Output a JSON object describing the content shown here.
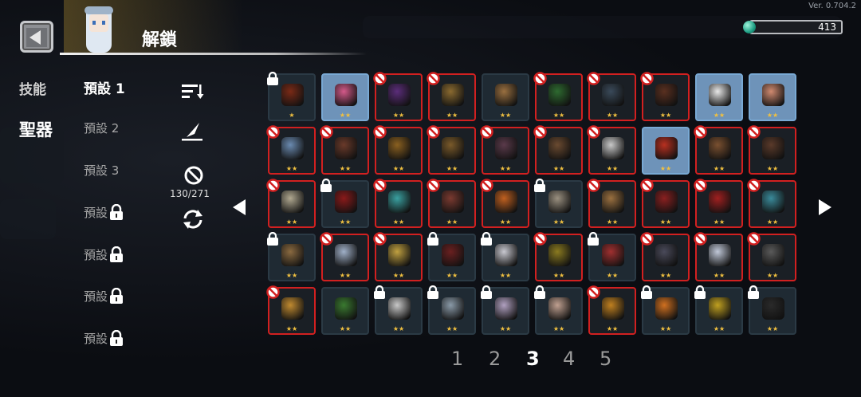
{
  "version": "Ver. 0.704.2",
  "header": {
    "title": "解鎖"
  },
  "currency": {
    "value": "413",
    "icon": "gem-icon",
    "color": "#2fc29f"
  },
  "categories": [
    {
      "label": "技能",
      "active": false
    },
    {
      "label": "聖器",
      "active": true
    }
  ],
  "presets": [
    {
      "label": "預設 1",
      "locked": false,
      "active": true
    },
    {
      "label": "預設 2",
      "locked": false,
      "active": false
    },
    {
      "label": "預設 3",
      "locked": false,
      "active": false
    },
    {
      "label": "預設",
      "locked": true,
      "active": false
    },
    {
      "label": "預設",
      "locked": true,
      "active": false
    },
    {
      "label": "預設",
      "locked": true,
      "active": false
    },
    {
      "label": "預設",
      "locked": true,
      "active": false
    }
  ],
  "tools": {
    "sort_icon": "sort-icon",
    "edit_icon": "quill-icon",
    "ban_icon": "ban-icon",
    "counter": "130/271",
    "refresh_icon": "refresh-icon"
  },
  "colors": {
    "blocked": "#d22020",
    "selected": "#79a9d4",
    "star": "#f0c040"
  },
  "items": [
    {
      "state": "locked",
      "stars": "★",
      "color": "#7a2a16"
    },
    {
      "state": "selected",
      "stars": "★★",
      "color": "#d45a8a"
    },
    {
      "state": "blocked",
      "stars": "★★",
      "color": "#5b2d7a"
    },
    {
      "state": "blocked",
      "stars": "★★",
      "color": "#8a6a30"
    },
    {
      "state": "normal",
      "stars": "★★",
      "color": "#9a7040"
    },
    {
      "state": "blocked",
      "stars": "★★",
      "color": "#2e6a30"
    },
    {
      "state": "blocked",
      "stars": "★★",
      "color": "#3a4a5a"
    },
    {
      "state": "blocked",
      "stars": "★★",
      "color": "#5a3020"
    },
    {
      "state": "selected",
      "stars": "★★",
      "color": "#e8e8e8"
    },
    {
      "state": "selected",
      "stars": "★★",
      "color": "#d08a70"
    },
    {
      "state": "blocked",
      "stars": "★★",
      "color": "#6a8ab0"
    },
    {
      "state": "blocked",
      "stars": "★★",
      "color": "#6a3a2a"
    },
    {
      "state": "blocked",
      "stars": "★★",
      "color": "#8a6020"
    },
    {
      "state": "blocked",
      "stars": "★★",
      "color": "#7a5a2a"
    },
    {
      "state": "blocked",
      "stars": "★★",
      "color": "#5a3a4a"
    },
    {
      "state": "blocked",
      "stars": "★★",
      "color": "#6a4a30"
    },
    {
      "state": "blocked",
      "stars": "★★",
      "color": "#c8c8c8"
    },
    {
      "state": "selected",
      "stars": "★★",
      "color": "#b83020"
    },
    {
      "state": "blocked",
      "stars": "★★",
      "color": "#7a5030"
    },
    {
      "state": "blocked",
      "stars": "★★",
      "color": "#5a3a2a"
    },
    {
      "state": "blocked",
      "stars": "★★",
      "color": "#b0a890"
    },
    {
      "state": "locked",
      "stars": "★★",
      "color": "#8a1a1a"
    },
    {
      "state": "blocked",
      "stars": "★★",
      "color": "#3aa0a0"
    },
    {
      "state": "blocked",
      "stars": "★★",
      "color": "#7a3a30"
    },
    {
      "state": "blocked",
      "stars": "★★",
      "color": "#c06020"
    },
    {
      "state": "locked",
      "stars": "★★",
      "color": "#9a9080"
    },
    {
      "state": "blocked",
      "stars": "★★",
      "color": "#9a7040"
    },
    {
      "state": "blocked",
      "stars": "★★",
      "color": "#8a2020"
    },
    {
      "state": "blocked",
      "stars": "★★",
      "color": "#a02020"
    },
    {
      "state": "blocked",
      "stars": "★★",
      "color": "#3a8a9a"
    },
    {
      "state": "locked",
      "stars": "★★",
      "color": "#8a6a40"
    },
    {
      "state": "blocked",
      "stars": "★★",
      "color": "#a0b0c8"
    },
    {
      "state": "blocked",
      "stars": "★★",
      "color": "#c0a040"
    },
    {
      "state": "locked",
      "stars": "★★",
      "color": "#6a2020"
    },
    {
      "state": "locked",
      "stars": "★★",
      "color": "#c8c8d0"
    },
    {
      "state": "blocked",
      "stars": "★★",
      "color": "#8a7a20"
    },
    {
      "state": "locked",
      "stars": "★★",
      "color": "#a03030"
    },
    {
      "state": "blocked",
      "stars": "★★",
      "color": "#4a4a5a"
    },
    {
      "state": "blocked",
      "stars": "★★",
      "color": "#c0c8d8"
    },
    {
      "state": "blocked",
      "stars": "★★",
      "color": "#5a5a5a"
    },
    {
      "state": "blocked",
      "stars": "★★",
      "color": "#c08a30"
    },
    {
      "state": "normal",
      "stars": "★★",
      "color": "#3a7a30"
    },
    {
      "state": "locked",
      "stars": "★★",
      "color": "#c8c8c8"
    },
    {
      "state": "locked",
      "stars": "★★",
      "color": "#8a9aa8"
    },
    {
      "state": "locked",
      "stars": "★★",
      "color": "#b0a0c0"
    },
    {
      "state": "locked",
      "stars": "★★",
      "color": "#c0a090"
    },
    {
      "state": "blocked",
      "stars": "★★",
      "color": "#c08020"
    },
    {
      "state": "locked",
      "stars": "★★",
      "color": "#d07020"
    },
    {
      "state": "locked",
      "stars": "★★",
      "color": "#c0a020"
    },
    {
      "state": "locked",
      "stars": "★★",
      "color": "#2a2a2a"
    }
  ],
  "pagination": {
    "pages": [
      "1",
      "2",
      "3",
      "4",
      "5"
    ],
    "current": "3"
  }
}
